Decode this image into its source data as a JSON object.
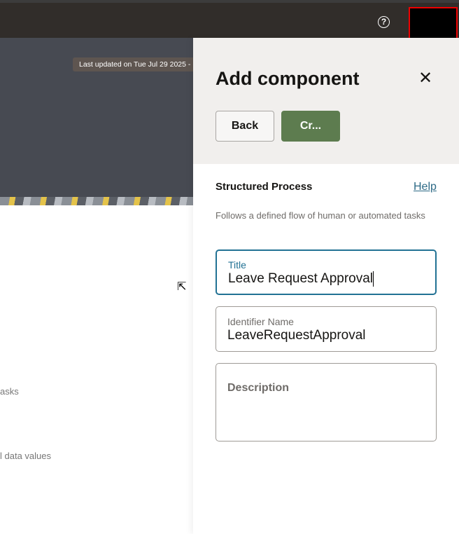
{
  "header": {
    "help_icon": "help-circle-icon"
  },
  "background": {
    "last_updated": "Last updated on Tue Jul 29 2025 -",
    "text_fragment_1": "asks",
    "text_fragment_2": "l data values"
  },
  "panel": {
    "title": "Add component",
    "back_label": "Back",
    "create_label": "Cr...",
    "section_title": "Structured Process",
    "help_link": "Help",
    "description": "Follows a defined flow of human or automated tasks",
    "fields": [
      {
        "label": "Title",
        "value": "Leave Request Approval"
      },
      {
        "label": "Identifier Name",
        "value": "LeaveRequestApproval"
      },
      {
        "label": "Description",
        "value": ""
      }
    ]
  },
  "colors": {
    "accent": "#227294",
    "primary_button": "#5d7c4f",
    "topbar": "#312d2a"
  }
}
